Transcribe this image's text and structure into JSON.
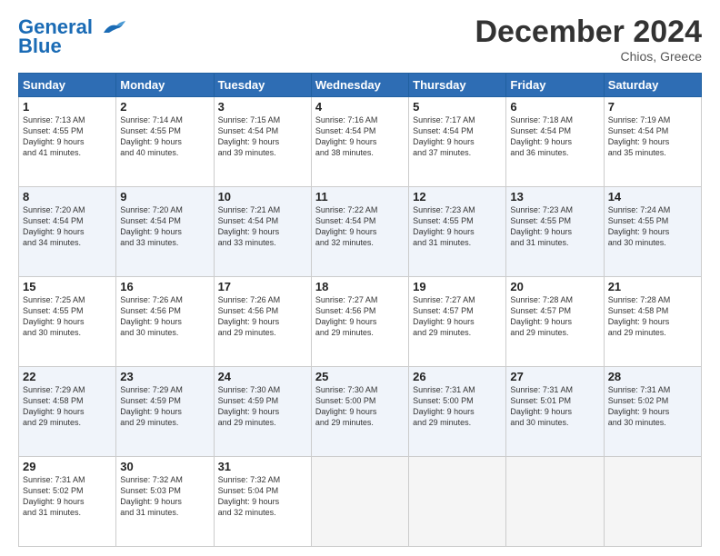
{
  "header": {
    "logo_line1": "General",
    "logo_line2": "Blue",
    "month_title": "December 2024",
    "location": "Chios, Greece"
  },
  "days_of_week": [
    "Sunday",
    "Monday",
    "Tuesday",
    "Wednesday",
    "Thursday",
    "Friday",
    "Saturday"
  ],
  "weeks": [
    [
      {
        "day": "1",
        "info": "Sunrise: 7:13 AM\nSunset: 4:55 PM\nDaylight: 9 hours\nand 41 minutes."
      },
      {
        "day": "2",
        "info": "Sunrise: 7:14 AM\nSunset: 4:55 PM\nDaylight: 9 hours\nand 40 minutes."
      },
      {
        "day": "3",
        "info": "Sunrise: 7:15 AM\nSunset: 4:54 PM\nDaylight: 9 hours\nand 39 minutes."
      },
      {
        "day": "4",
        "info": "Sunrise: 7:16 AM\nSunset: 4:54 PM\nDaylight: 9 hours\nand 38 minutes."
      },
      {
        "day": "5",
        "info": "Sunrise: 7:17 AM\nSunset: 4:54 PM\nDaylight: 9 hours\nand 37 minutes."
      },
      {
        "day": "6",
        "info": "Sunrise: 7:18 AM\nSunset: 4:54 PM\nDaylight: 9 hours\nand 36 minutes."
      },
      {
        "day": "7",
        "info": "Sunrise: 7:19 AM\nSunset: 4:54 PM\nDaylight: 9 hours\nand 35 minutes."
      }
    ],
    [
      {
        "day": "8",
        "info": "Sunrise: 7:20 AM\nSunset: 4:54 PM\nDaylight: 9 hours\nand 34 minutes."
      },
      {
        "day": "9",
        "info": "Sunrise: 7:20 AM\nSunset: 4:54 PM\nDaylight: 9 hours\nand 33 minutes."
      },
      {
        "day": "10",
        "info": "Sunrise: 7:21 AM\nSunset: 4:54 PM\nDaylight: 9 hours\nand 33 minutes."
      },
      {
        "day": "11",
        "info": "Sunrise: 7:22 AM\nSunset: 4:54 PM\nDaylight: 9 hours\nand 32 minutes."
      },
      {
        "day": "12",
        "info": "Sunrise: 7:23 AM\nSunset: 4:55 PM\nDaylight: 9 hours\nand 31 minutes."
      },
      {
        "day": "13",
        "info": "Sunrise: 7:23 AM\nSunset: 4:55 PM\nDaylight: 9 hours\nand 31 minutes."
      },
      {
        "day": "14",
        "info": "Sunrise: 7:24 AM\nSunset: 4:55 PM\nDaylight: 9 hours\nand 30 minutes."
      }
    ],
    [
      {
        "day": "15",
        "info": "Sunrise: 7:25 AM\nSunset: 4:55 PM\nDaylight: 9 hours\nand 30 minutes."
      },
      {
        "day": "16",
        "info": "Sunrise: 7:26 AM\nSunset: 4:56 PM\nDaylight: 9 hours\nand 30 minutes."
      },
      {
        "day": "17",
        "info": "Sunrise: 7:26 AM\nSunset: 4:56 PM\nDaylight: 9 hours\nand 29 minutes."
      },
      {
        "day": "18",
        "info": "Sunrise: 7:27 AM\nSunset: 4:56 PM\nDaylight: 9 hours\nand 29 minutes."
      },
      {
        "day": "19",
        "info": "Sunrise: 7:27 AM\nSunset: 4:57 PM\nDaylight: 9 hours\nand 29 minutes."
      },
      {
        "day": "20",
        "info": "Sunrise: 7:28 AM\nSunset: 4:57 PM\nDaylight: 9 hours\nand 29 minutes."
      },
      {
        "day": "21",
        "info": "Sunrise: 7:28 AM\nSunset: 4:58 PM\nDaylight: 9 hours\nand 29 minutes."
      }
    ],
    [
      {
        "day": "22",
        "info": "Sunrise: 7:29 AM\nSunset: 4:58 PM\nDaylight: 9 hours\nand 29 minutes."
      },
      {
        "day": "23",
        "info": "Sunrise: 7:29 AM\nSunset: 4:59 PM\nDaylight: 9 hours\nand 29 minutes."
      },
      {
        "day": "24",
        "info": "Sunrise: 7:30 AM\nSunset: 4:59 PM\nDaylight: 9 hours\nand 29 minutes."
      },
      {
        "day": "25",
        "info": "Sunrise: 7:30 AM\nSunset: 5:00 PM\nDaylight: 9 hours\nand 29 minutes."
      },
      {
        "day": "26",
        "info": "Sunrise: 7:31 AM\nSunset: 5:00 PM\nDaylight: 9 hours\nand 29 minutes."
      },
      {
        "day": "27",
        "info": "Sunrise: 7:31 AM\nSunset: 5:01 PM\nDaylight: 9 hours\nand 30 minutes."
      },
      {
        "day": "28",
        "info": "Sunrise: 7:31 AM\nSunset: 5:02 PM\nDaylight: 9 hours\nand 30 minutes."
      }
    ],
    [
      {
        "day": "29",
        "info": "Sunrise: 7:31 AM\nSunset: 5:02 PM\nDaylight: 9 hours\nand 31 minutes."
      },
      {
        "day": "30",
        "info": "Sunrise: 7:32 AM\nSunset: 5:03 PM\nDaylight: 9 hours\nand 31 minutes."
      },
      {
        "day": "31",
        "info": "Sunrise: 7:32 AM\nSunset: 5:04 PM\nDaylight: 9 hours\nand 32 minutes."
      },
      {
        "day": "",
        "info": ""
      },
      {
        "day": "",
        "info": ""
      },
      {
        "day": "",
        "info": ""
      },
      {
        "day": "",
        "info": ""
      }
    ]
  ]
}
